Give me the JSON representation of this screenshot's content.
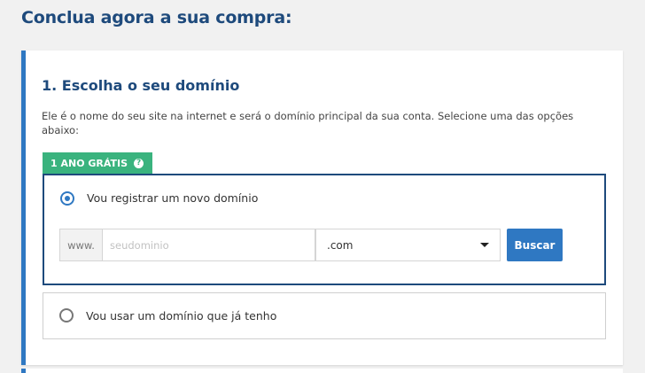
{
  "page": {
    "title": "Conclua agora a sua compra:"
  },
  "step": {
    "title": "1. Escolha o seu domínio",
    "description": "Ele é o nome do seu site na internet e será o domínio principal da sua conta. Selecione uma das opções abaixo:",
    "badge": {
      "label": "1 ANO GRÁTIS",
      "icon": "question-circle-icon"
    }
  },
  "options": {
    "new_domain": {
      "label": "Vou registrar um novo domínio",
      "selected": true,
      "prefix": "www.",
      "input_placeholder": "seudominio",
      "input_value": "",
      "tld_selected": ".com",
      "search_label": "Buscar"
    },
    "existing_domain": {
      "label": "Vou usar um domínio que já tenho",
      "selected": false
    }
  },
  "colors": {
    "title": "#1e4a7c",
    "accent": "#2f78c2",
    "badge": "#3ab37e",
    "background": "#f1f1f1"
  }
}
